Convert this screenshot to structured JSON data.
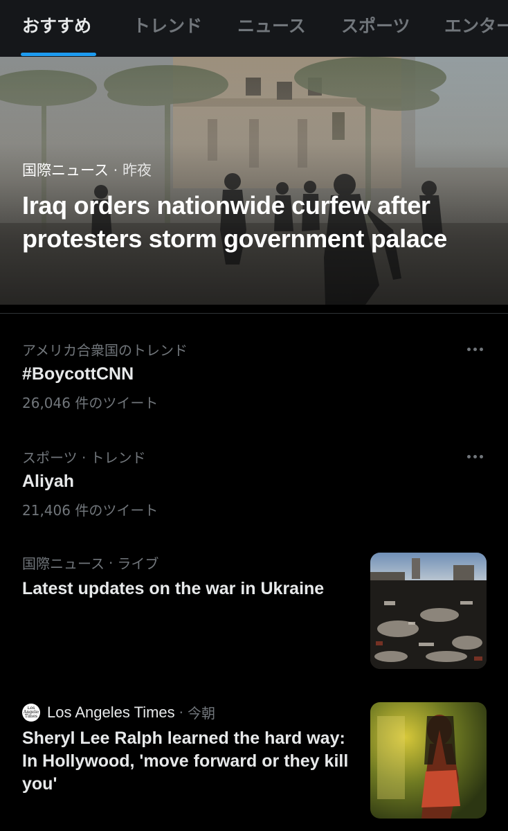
{
  "tabs": [
    {
      "label": "おすすめ",
      "active": true
    },
    {
      "label": "トレンド",
      "active": false
    },
    {
      "label": "ニュース",
      "active": false
    },
    {
      "label": "スポーツ",
      "active": false
    },
    {
      "label": "エンター",
      "active": false
    }
  ],
  "hero": {
    "category": "国際ニュース",
    "separator": "·",
    "time": "昨夜",
    "title": "Iraq orders nationwide curfew after protesters storm government palace"
  },
  "trends": [
    {
      "context": "アメリカ合衆国のトレンド",
      "name": "#BoycottCNN",
      "count": "26,046 件のツイート"
    },
    {
      "context": "スポーツ · トレンド",
      "name": "Aliyah",
      "count": "21,406 件のツイート"
    }
  ],
  "news": [
    {
      "category": "国際ニュース",
      "separator": "·",
      "time": "ライブ",
      "title": "Latest updates on the war in Ukraine"
    },
    {
      "source": "Los Angeles Times",
      "logo_text": "Los Angeles Times",
      "separator": "·",
      "time": "今朝",
      "title": "Sheryl Lee Ralph learned the hard way: In Hollywood, 'move forward or they kill you'"
    }
  ],
  "colors": {
    "accent": "#1d9bf0",
    "background": "#000000",
    "tab_bar": "#15171a",
    "text_primary": "#e7e9ea",
    "text_secondary": "#71767b"
  },
  "icons": {
    "more": "more-horizontal-icon",
    "publisher_logo": "los-angeles-times-logo"
  }
}
